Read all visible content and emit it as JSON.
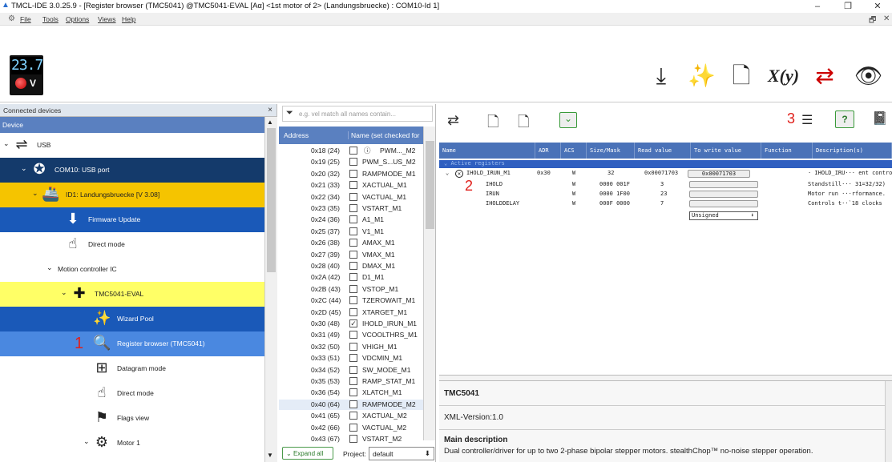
{
  "window": {
    "title": "TMCL-IDE 3.0.25.9 - [Register browser (TMC5041) @TMC5041-EVAL [Aα] <1st motor of 2> (Landungsbruecke) : COM10-Id 1]",
    "minimize": "–",
    "restore": "❐",
    "close": "✕"
  },
  "menu": {
    "items": [
      "File",
      "Tools",
      "Options",
      "Views",
      "Help"
    ],
    "restore": "🗗",
    "close": "✕"
  },
  "toolbar": {
    "voltage": "23.7",
    "unit": "V",
    "icons": [
      "download-icon",
      "wand-icon",
      "file-code-icon",
      "xy-function-icon",
      "transfer-icon",
      "eye-icon"
    ],
    "xy_label": "X(y)"
  },
  "devices": {
    "title": "Connected devices",
    "close": "×",
    "column": "Device",
    "rows": [
      {
        "label": "USB",
        "icon": "⇌",
        "indent": 8,
        "bg": "#ffffff",
        "fg": "#222222",
        "chev": "⌄"
      },
      {
        "label": "COM10: USB port",
        "icon": "✪",
        "indent": 30,
        "bg": "#143a6b",
        "fg": "#ffffff",
        "chev": "⌄"
      },
      {
        "label": "ID1: Landungsbruecke [V 3.08]",
        "icon": "🚢",
        "indent": 44,
        "bg": "#f5c400",
        "fg": "#222222",
        "chev": "⌄"
      },
      {
        "label": "Firmware Update",
        "icon": "⬇",
        "indent": 72,
        "bg": "#1a59b8",
        "fg": "#ffffff",
        "chev": ""
      },
      {
        "label": "Direct mode",
        "icon": "☝",
        "indent": 72,
        "bg": "#ffffff",
        "fg": "#222222",
        "chev": ""
      },
      {
        "label": "Motion controller IC",
        "icon": "",
        "indent": 62,
        "bg": "#ffffff",
        "fg": "#222222",
        "chev": "⌄"
      },
      {
        "label": "TMC5041-EVAL",
        "icon": "✚",
        "indent": 80,
        "bg": "#ffff66",
        "fg": "#222222",
        "chev": "⌄"
      },
      {
        "label": "Wizard Pool",
        "icon": "✨",
        "indent": 108,
        "bg": "#1a59b8",
        "fg": "#ffffff",
        "chev": ""
      },
      {
        "label": "Register browser (TMC5041)",
        "icon": "🔍",
        "indent": 108,
        "bg": "#4a88e0",
        "fg": "#ffffff",
        "chev": ""
      },
      {
        "label": "Datagram mode",
        "icon": "⊞",
        "indent": 108,
        "bg": "#ffffff",
        "fg": "#222222",
        "chev": ""
      },
      {
        "label": "Direct mode",
        "icon": "☝",
        "indent": 108,
        "bg": "#ffffff",
        "fg": "#222222",
        "chev": ""
      },
      {
        "label": "Flags view",
        "icon": "⚑",
        "indent": 108,
        "bg": "#ffffff",
        "fg": "#222222",
        "chev": ""
      },
      {
        "label": "Motor 1",
        "icon": "⚙",
        "indent": 108,
        "bg": "#ffffff",
        "fg": "#222222",
        "chev": "⌄"
      }
    ],
    "annotation": "1"
  },
  "registers": {
    "filter_placeholder": "e.g. vel match all names contain...",
    "col_address": "Address",
    "col_name": "Name (set checked for",
    "rows": [
      [
        "0x18 (24)",
        "PWM..._M2",
        false,
        true
      ],
      [
        "0x19 (25)",
        "PWM_S...US_M2",
        false,
        false
      ],
      [
        "0x20 (32)",
        "RAMPMODE_M1",
        false,
        false
      ],
      [
        "0x21 (33)",
        "XACTUAL_M1",
        false,
        false
      ],
      [
        "0x22 (34)",
        "VACTUAL_M1",
        false,
        false
      ],
      [
        "0x23 (35)",
        "VSTART_M1",
        false,
        false
      ],
      [
        "0x24 (36)",
        "A1_M1",
        false,
        false
      ],
      [
        "0x25 (37)",
        "V1_M1",
        false,
        false
      ],
      [
        "0x26 (38)",
        "AMAX_M1",
        false,
        false
      ],
      [
        "0x27 (39)",
        "VMAX_M1",
        false,
        false
      ],
      [
        "0x28 (40)",
        "DMAX_M1",
        false,
        false
      ],
      [
        "0x2A (42)",
        "D1_M1",
        false,
        false
      ],
      [
        "0x2B (43)",
        "VSTOP_M1",
        false,
        false
      ],
      [
        "0x2C (44)",
        "TZEROWAIT_M1",
        false,
        false
      ],
      [
        "0x2D (45)",
        "XTARGET_M1",
        false,
        false
      ],
      [
        "0x30 (48)",
        "IHOLD_IRUN_M1",
        true,
        false
      ],
      [
        "0x31 (49)",
        "VCOOLTHRS_M1",
        false,
        false
      ],
      [
        "0x32 (50)",
        "VHIGH_M1",
        false,
        false
      ],
      [
        "0x33 (51)",
        "VDCMIN_M1",
        false,
        false
      ],
      [
        "0x34 (52)",
        "SW_MODE_M1",
        false,
        false
      ],
      [
        "0x35 (53)",
        "RAMP_STAT_M1",
        false,
        false
      ],
      [
        "0x36 (54)",
        "XLATCH_M1",
        false,
        false
      ],
      [
        "0x40 (64)",
        "RAMPMODE_M2",
        false,
        false
      ],
      [
        "0x41 (65)",
        "XACTUAL_M2",
        false,
        false
      ],
      [
        "0x42 (66)",
        "VACTUAL_M2",
        false,
        false
      ],
      [
        "0x43 (67)",
        "VSTART_M2",
        false,
        false
      ]
    ],
    "expand_all": "Expand all",
    "project_label": "Project:",
    "project_value": "default"
  },
  "browser": {
    "annotation3": "3",
    "help": "?",
    "columns": [
      "Name",
      "ADR",
      "ACS",
      "Size/Mask",
      "Read value",
      "To write value",
      "Function",
      "Description(s)"
    ],
    "group": "Active registers",
    "main": {
      "name": "IHOLD_IRUN_M1",
      "adr": "0x30",
      "acs": "W",
      "size": "32",
      "read": "0x00071703",
      "write": "0x00071703",
      "desc": "· IHOLD_IRU··· ent control"
    },
    "fields": [
      {
        "name": "IHOLD",
        "acs": "W",
        "size": "0000 001F",
        "read": "3",
        "desc": "Standstill··· 31=32/32)"
      },
      {
        "name": "IRUN",
        "acs": "W",
        "size": "0000 1F00",
        "read": "23",
        "desc": "Motor run ···rformance."
      },
      {
        "name": "IHOLDDELAY",
        "acs": "W",
        "size": "000F 0000",
        "read": "7",
        "desc": "Controls t··`18 clocks"
      }
    ],
    "dropdown": "Unsigned",
    "annotation2": "2",
    "info_title": "TMC5041",
    "xml_version": "XML-Version:1.0",
    "main_desc_title": "Main description",
    "main_desc": "Dual controller/driver for up to two 2-phase bipolar stepper motors. stealthChop™ no-noise stepper operation."
  }
}
